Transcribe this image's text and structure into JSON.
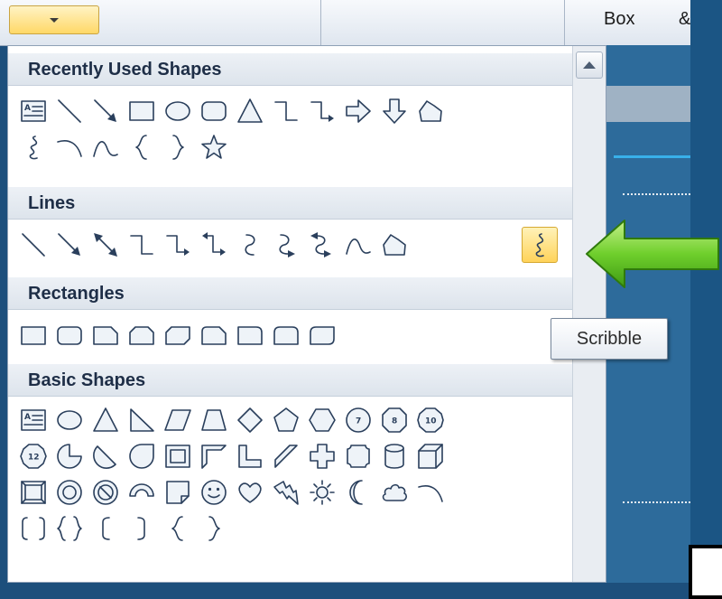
{
  "ribbon": {
    "text_box": "Box",
    "text_amp": "&"
  },
  "gallery": {
    "sections": [
      {
        "title": "Recently Used Shapes"
      },
      {
        "title": "Lines"
      },
      {
        "title": "Rectangles"
      },
      {
        "title": "Basic Shapes"
      }
    ]
  },
  "tooltip": {
    "text": "Scribble"
  },
  "colors": {
    "highlight": "#ffd35a",
    "arrow": "#5cbf25",
    "accent_blue": "#38b0ea",
    "background": "#1d4f7c"
  }
}
